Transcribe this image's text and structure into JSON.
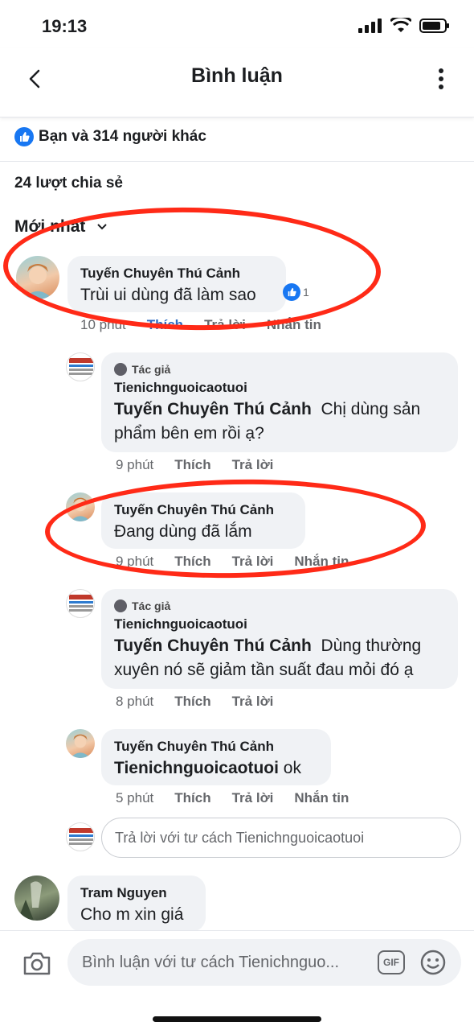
{
  "status": {
    "time": "19:13"
  },
  "header": {
    "title": "Bình luận"
  },
  "likes": {
    "text": "Bạn và 314 người khác"
  },
  "shares": {
    "text": "24 lượt chia sẻ"
  },
  "sort": {
    "label": "Mới nhất"
  },
  "comments": [
    {
      "name": "Tuyến Chuyên Thú Cảnh",
      "text": "Trùi ui dùng đã làm sao",
      "reactions": "1",
      "time": "10 phút",
      "like": "Thích",
      "reply": "Trả lời",
      "message": "Nhắn tin"
    }
  ],
  "replies": [
    {
      "author_tag": "Tác giả",
      "name": "Tienichnguoicaotuoi",
      "mention": "Tuyến Chuyên Thú Cảnh",
      "text": "Chị dùng sản phẩm bên em rồi ạ?",
      "time": "9 phút",
      "like": "Thích",
      "reply": "Trả lời"
    },
    {
      "name": "Tuyến Chuyên Thú Cảnh",
      "text": "Đang dùng đã lắm",
      "time": "9 phút",
      "like": "Thích",
      "reply": "Trả lời",
      "message": "Nhắn tin"
    },
    {
      "author_tag": "Tác giả",
      "name": "Tienichnguoicaotuoi",
      "mention": "Tuyến Chuyên Thú Cảnh",
      "text": "Dùng thường xuyên nó sẽ giảm tần suất đau mỏi đó ạ",
      "time": "8 phút",
      "like": "Thích",
      "reply": "Trả lời"
    },
    {
      "name": "Tuyến Chuyên Thú Cảnh",
      "mention": "Tienichnguoicaotuoi",
      "text": "ok",
      "time": "5 phút",
      "like": "Thích",
      "reply": "Trả lời",
      "message": "Nhắn tin"
    }
  ],
  "reply_input": {
    "placeholder": "Trả lời với tư cách Tienichnguoicaotuoi"
  },
  "next_comment": {
    "name": "Tram Nguyen",
    "text": "Cho m xin giá"
  },
  "composer": {
    "placeholder": "Bình luận với tư cách Tienichnguo...",
    "gif": "GIF"
  },
  "colors": {
    "accent": "#1877f2",
    "liked": "#2d6bc3",
    "bubble": "#f0f2f5",
    "annotation": "#ff2a17"
  }
}
